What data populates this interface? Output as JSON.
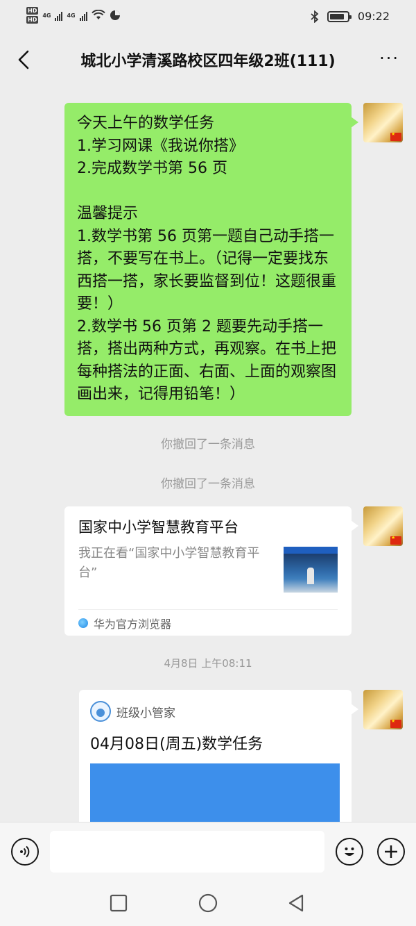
{
  "status_bar": {
    "hd1": "HD",
    "hd2": "HD",
    "net1": "4G",
    "net2": "4G",
    "time": "09:22",
    "icons": [
      "signal-icon",
      "wifi-icon",
      "bluetooth-icon",
      "battery-icon"
    ]
  },
  "header": {
    "title": "城北小学清溪路校区四年级2班(111)",
    "back_icon": "chevron-left-icon",
    "more_icon": "more-dots-icon",
    "more_text": "···"
  },
  "messages": {
    "task_text": "今天上午的数学任务\n1.学习网课《我说你搭》\n2.完成数学书第 56 页\n\n温馨提示\n1.数学书第 56 页第一题自己动手搭一搭，不要写在书上。（记得一定要找东西搭一搭，家长要监督到位！这题很重要！）\n2.数学书 56 页第 2 题要先动手搭一搭，搭出两种方式，再观察。在书上把每种搭法的正面、右面、上面的观察图画出来，记得用铅笔！）",
    "recall_1": "你撤回了一条消息",
    "recall_2": "你撤回了一条消息",
    "link_card": {
      "title": "国家中小学智慧教育平台",
      "description": "我正在看“国家中小学智慧教育平台”",
      "source": "华为官方浏览器"
    },
    "timestamp": "4月8日 上午08:11",
    "app_card": {
      "app_name": "班级小管家",
      "title": "04月08日(周五)数学任务"
    }
  },
  "input_bar": {
    "voice_icon": "voice-icon",
    "emoji_icon": "emoji-icon",
    "plus_icon": "plus-icon",
    "accent": "#95ec69"
  },
  "system_nav": [
    "square-icon",
    "circle-icon",
    "triangle-back-icon"
  ]
}
